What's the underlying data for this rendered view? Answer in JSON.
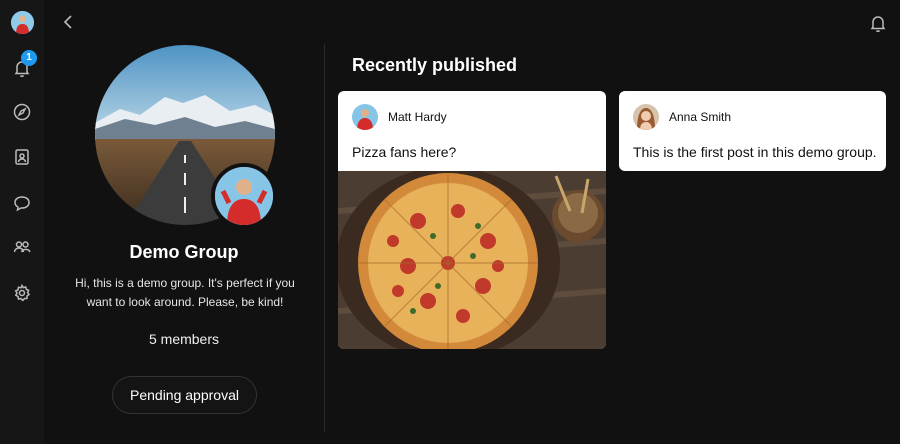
{
  "rail": {
    "notification_count": "1",
    "icons": [
      "avatar",
      "bell-icon",
      "compass-icon",
      "contacts-icon",
      "chat-icon",
      "people-icon",
      "settings-icon"
    ]
  },
  "header": {
    "back_icon": "chevron-left-icon",
    "notifications_icon": "bell-icon"
  },
  "group": {
    "name": "Demo Group",
    "description": "Hi, this is a demo group. It's perfect if you want to look around. Please, be kind!",
    "members": "5 members",
    "pending_button": "Pending approval"
  },
  "feed": {
    "title": "Recently published",
    "posts": [
      {
        "author": "Matt Hardy",
        "text": "Pizza fans here?",
        "has_image": true
      },
      {
        "author": "Anna Smith",
        "text": "This is the first post in this demo group.",
        "has_image": false
      }
    ]
  },
  "colors": {
    "background": "#111111",
    "rail": "#161616",
    "badge": "#1d9bf0",
    "card": "#ffffff"
  }
}
